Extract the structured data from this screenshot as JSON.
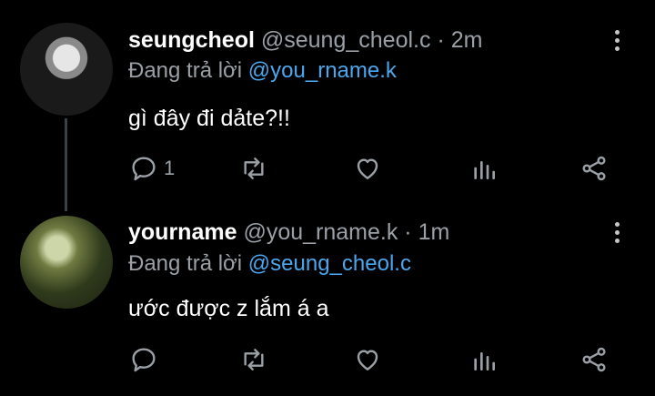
{
  "tweets": [
    {
      "name": "seungcheol",
      "handle": "@seung_cheol.c",
      "time": "· 2m",
      "reply_prefix": "Đang trả lời",
      "reply_to": "@you_rname.k",
      "text": "gì đây đi dảte?!!",
      "reply_count": "1"
    },
    {
      "name": "yourname",
      "handle": "@you_rname.k",
      "time": "· 1m",
      "reply_prefix": "Đang trả lời",
      "reply_to": "@seung_cheol.c",
      "text": "ước được z lắm á a",
      "reply_count": ""
    }
  ],
  "icons": {
    "reply": "reply-icon",
    "retweet": "retweet-icon",
    "like": "heart-icon",
    "stats": "stats-icon",
    "share": "share-icon",
    "more": "more-vertical-icon"
  },
  "colors": {
    "background": "#000000",
    "mention": "#4aa7ee",
    "secondary_text": "#9aa0a6"
  }
}
